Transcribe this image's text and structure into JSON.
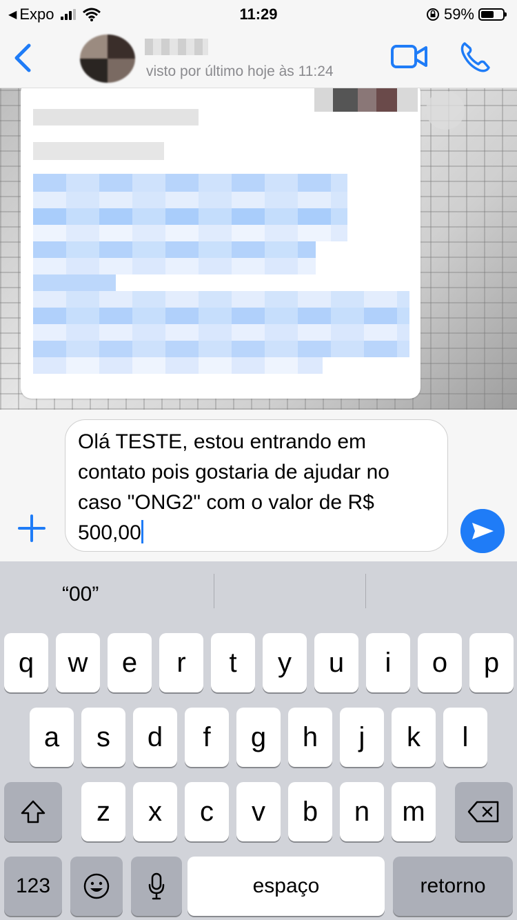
{
  "status_bar": {
    "carrier": "Expo",
    "time": "11:29",
    "battery": "59%",
    "battery_level": 0.59,
    "signal_bars": 3
  },
  "header": {
    "last_seen": "visto por último hoje às 11:24",
    "back_icon": "chevron-left-icon",
    "video_icon": "video-camera-icon",
    "phone_icon": "phone-icon"
  },
  "composer": {
    "text": "Olá TESTE, estou entrando em contato pois gostaria de ajudar no caso \"ONG2\" com o valor de R$ 500,00",
    "plus_icon": "plus-icon",
    "send_icon": "send-icon"
  },
  "keyboard": {
    "suggestions": [
      "“00”",
      "",
      ""
    ],
    "row1": [
      "q",
      "w",
      "e",
      "r",
      "t",
      "y",
      "u",
      "i",
      "o",
      "p"
    ],
    "row2": [
      "a",
      "s",
      "d",
      "f",
      "g",
      "h",
      "j",
      "k",
      "l"
    ],
    "row3": [
      "z",
      "x",
      "c",
      "v",
      "b",
      "n",
      "m"
    ],
    "numbers_label": "123",
    "space_label": "espaço",
    "return_label": "retorno"
  },
  "colors": {
    "accent": "#1f7cf7",
    "keyboard_bg": "#d1d3d9",
    "dark_key": "#acafb8"
  }
}
